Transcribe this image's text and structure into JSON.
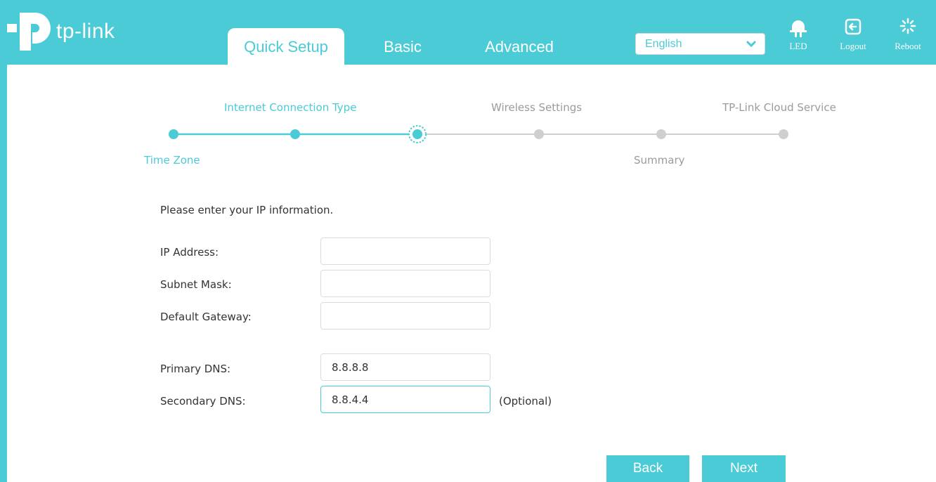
{
  "brand": {
    "name": "tp-link",
    "accent": "#4acbd6"
  },
  "nav": {
    "tabs": [
      {
        "label": "Quick Setup",
        "active": true
      },
      {
        "label": "Basic",
        "active": false
      },
      {
        "label": "Advanced",
        "active": false
      }
    ],
    "language": "English",
    "buttons": {
      "led": "LED",
      "logout": "Logout",
      "reboot": "Reboot"
    }
  },
  "wizard": {
    "steps": {
      "time_zone": "Time Zone",
      "internet_connection_type": "Internet Connection Type",
      "wireless_settings": "Wireless Settings",
      "summary": "Summary",
      "cloud_service": "TP-Link Cloud Service"
    }
  },
  "form": {
    "intro": "Please enter your IP information.",
    "ip_address": {
      "label": "IP Address:",
      "value": ""
    },
    "subnet_mask": {
      "label": "Subnet Mask:",
      "value": ""
    },
    "default_gateway": {
      "label": "Default Gateway:",
      "value": ""
    },
    "primary_dns": {
      "label": "Primary DNS:",
      "value": "8.8.8.8"
    },
    "secondary_dns": {
      "label": "Secondary DNS:",
      "value": "8.8.4.4",
      "note": "(Optional)"
    }
  },
  "actions": {
    "back": "Back",
    "next": "Next"
  }
}
